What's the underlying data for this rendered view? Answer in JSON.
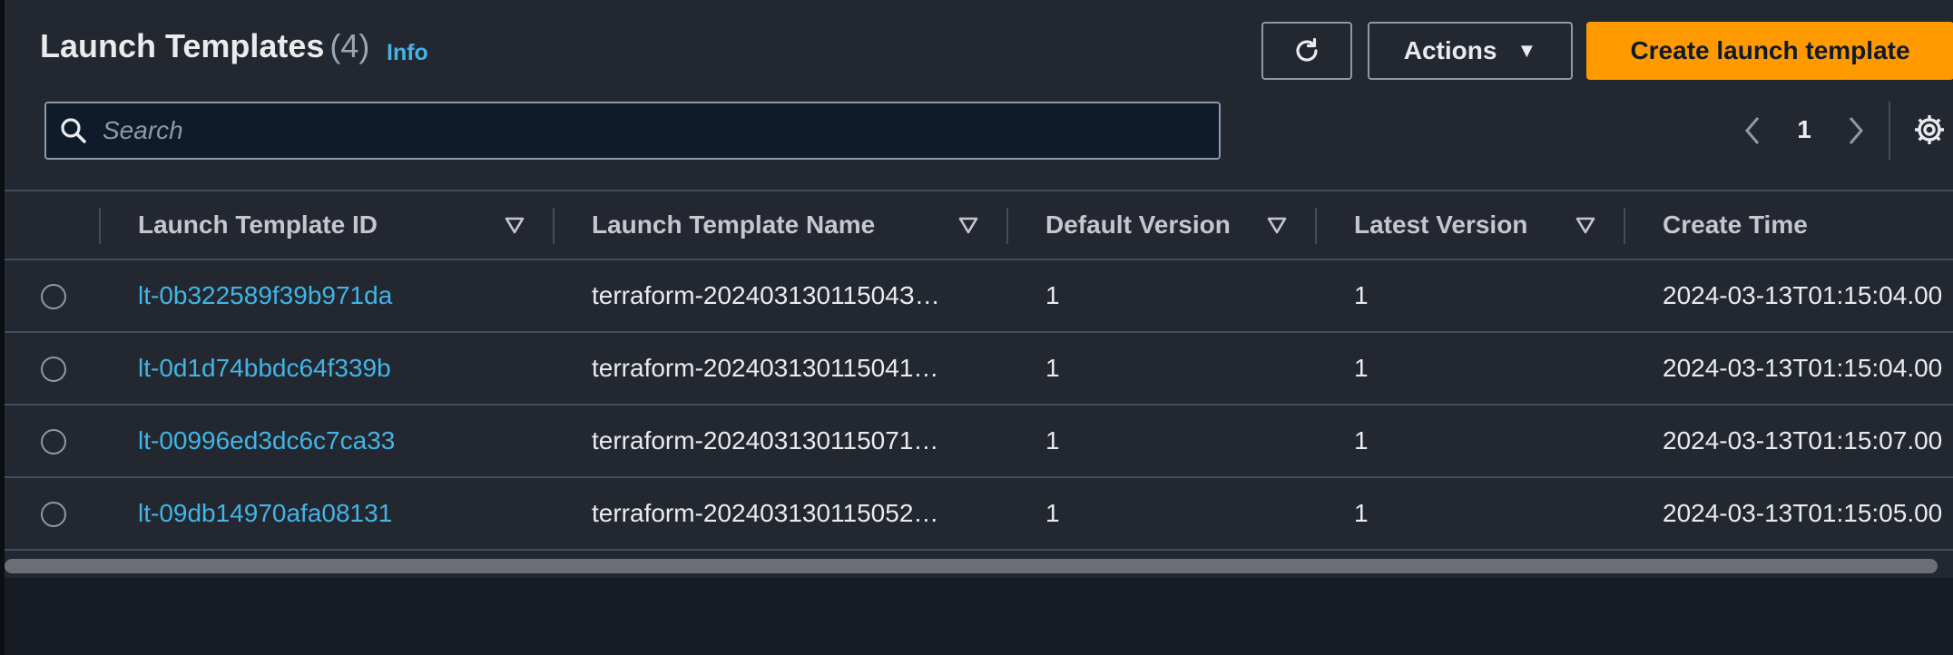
{
  "header": {
    "title": "Launch Templates",
    "count": "(4)",
    "info_label": "Info",
    "refresh_icon": "refresh-icon",
    "actions_label": "Actions",
    "actions_caret": "▼",
    "create_label": "Create launch template"
  },
  "search": {
    "placeholder": "Search",
    "value": "",
    "icon": "search-icon"
  },
  "pagination": {
    "current_page": "1",
    "prev_icon": "chevron-left-icon",
    "next_icon": "chevron-right-icon",
    "settings_icon": "gear-icon"
  },
  "table": {
    "columns": [
      {
        "label": "Launch Template ID",
        "sortable": true
      },
      {
        "label": "Launch Template Name",
        "sortable": true
      },
      {
        "label": "Default Version",
        "sortable": true
      },
      {
        "label": "Latest Version",
        "sortable": true
      },
      {
        "label": "Create Time",
        "sortable": true
      }
    ],
    "rows": [
      {
        "id": "lt-0b322589f39b971da",
        "name": "terraform-20240313011504З…",
        "default_version": "1",
        "latest_version": "1",
        "create_time": "2024-03-13T01:15:04.00"
      },
      {
        "id": "lt-0d1d74bbdc64f339b",
        "name": "terraform-20240313011504​1…",
        "default_version": "1",
        "latest_version": "1",
        "create_time": "2024-03-13T01:15:04.00"
      },
      {
        "id": "lt-00996ed3dc6c7ca33",
        "name": "terraform-20240313011507​1…",
        "default_version": "1",
        "latest_version": "1",
        "create_time": "2024-03-13T01:15:07.00"
      },
      {
        "id": "lt-09db14970afa08131",
        "name": "terraform-20240313011505​2…",
        "default_version": "1",
        "latest_version": "1",
        "create_time": "2024-03-13T01:15:05.00"
      }
    ]
  },
  "colors": {
    "background": "#161b24",
    "panel": "#232830",
    "accent_orange": "#ff9900",
    "link_blue": "#42b4e6",
    "border": "#414d5c"
  }
}
